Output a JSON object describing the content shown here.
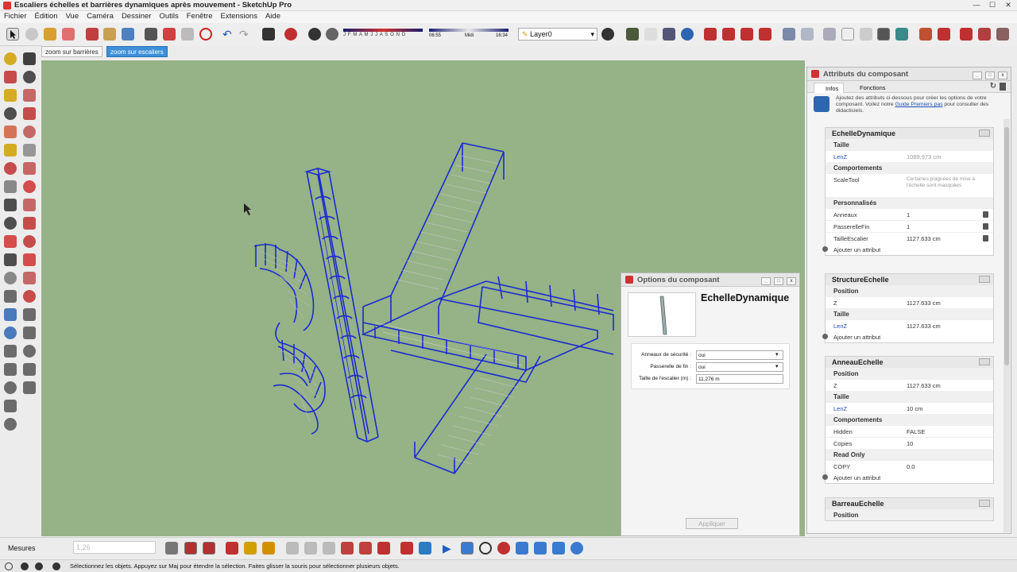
{
  "window": {
    "title": "Escaliers échelles et barrières dynamiques après mouvement - SketchUp Pro"
  },
  "menu": [
    "Fichier",
    "Édition",
    "Vue",
    "Caméra",
    "Dessiner",
    "Outils",
    "Fenêtre",
    "Extensions",
    "Aide"
  ],
  "toolbar": {
    "layer": "Layer0",
    "shadow_months": "J F M A M J J A S O N D",
    "time_start": "06:55",
    "time_mid": "Midi",
    "time_end": "16:34"
  },
  "scenes": [
    {
      "label": "zoom sur barrières",
      "active": false
    },
    {
      "label": "zoom sur escaliers",
      "active": true
    }
  ],
  "attributes_panel": {
    "title": "Attributs du composant",
    "tabs": [
      "Infos",
      "Fonctions"
    ],
    "info_text": "Ajoutez des attributs ci-dessous pour créer les options de votre composant. Voilez notre",
    "info_link": "Guide Premiers pas",
    "info_text2": "pour consulter des didacticiels.",
    "add_label": "Ajouter un attribut",
    "components": [
      {
        "name": "EchelleDynamique",
        "sections": [
          {
            "title": "Taille",
            "rows": [
              {
                "key": "LenZ",
                "value": "1089,973 cm",
                "blue": true,
                "grey": true
              }
            ]
          },
          {
            "title": "Comportements",
            "rows": [
              {
                "key": "ScaleTool",
                "value": "Certaines poignées de mise à l'échelle sont masquées",
                "grey": true
              }
            ]
          },
          {
            "title": "Personnalisés",
            "rows": [
              {
                "key": "Anneaux",
                "value": "1",
                "icon": true
              },
              {
                "key": "PasserelleFin",
                "value": "1",
                "icon": true
              },
              {
                "key": "TailleEscalier",
                "value": "1127.633 cm",
                "icon": true
              }
            ]
          }
        ]
      },
      {
        "name": "StructureEchelle",
        "sections": [
          {
            "title": "Position",
            "rows": [
              {
                "key": "Z",
                "value": "1127.633 cm"
              }
            ]
          },
          {
            "title": "Taille",
            "rows": [
              {
                "key": "LenZ",
                "value": "1127.633 cm",
                "blue": true
              }
            ]
          }
        ]
      },
      {
        "name": "AnneauEchelle",
        "sections": [
          {
            "title": "Position",
            "rows": [
              {
                "key": "Z",
                "value": "1127.633 cm"
              }
            ]
          },
          {
            "title": "Taille",
            "rows": [
              {
                "key": "LenZ",
                "value": "10 cm",
                "blue": true
              }
            ]
          },
          {
            "title": "Comportements",
            "rows": [
              {
                "key": "Hidden",
                "value": "FALSE"
              },
              {
                "key": "Copies",
                "value": "10"
              }
            ]
          },
          {
            "title": "Read Only",
            "rows": [
              {
                "key": "COPY",
                "value": "0.0"
              }
            ]
          }
        ]
      },
      {
        "name": "BarreauEchelle",
        "sections": [
          {
            "title": "Position",
            "rows": []
          }
        ]
      }
    ]
  },
  "options_panel": {
    "title": "Options du composant",
    "component_name": "EchelleDynamique",
    "fields": [
      {
        "label": "Anneaux de sécurité :",
        "value": "oui"
      },
      {
        "label": "Passerelle de fin :",
        "value": "oui"
      },
      {
        "label": "Taille de l'escalier (m) :",
        "value": "11,276 m"
      }
    ],
    "apply": "Appliquer"
  },
  "bottom": {
    "measures_label": "Mesures",
    "measures_value": "1,26"
  },
  "status": {
    "text": "Sélectionnez les objets. Appuyez sur Maj pour étendre la sélection. Faites glisser la souris pour sélectionner plusieurs objets."
  },
  "colors": {
    "viewport": "#96b287",
    "model_blue": "#1b2bd0",
    "select_blue": "#3d8fd8"
  }
}
